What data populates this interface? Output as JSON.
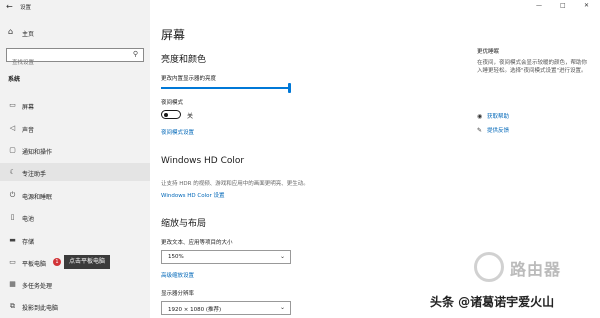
{
  "window": {
    "title": "设置",
    "controls": [
      "—",
      "□",
      "✕"
    ]
  },
  "sidebar": {
    "home_label": "主页",
    "search_placeholder": "查找设置",
    "section": "系统",
    "items": [
      {
        "label": "屏幕",
        "icon": "monitor-icon"
      },
      {
        "label": "声音",
        "icon": "speaker-icon"
      },
      {
        "label": "通知和操作",
        "icon": "notification-icon"
      },
      {
        "label": "专注助手",
        "icon": "moon-icon"
      },
      {
        "label": "电源和睡眠",
        "icon": "power-icon"
      },
      {
        "label": "电池",
        "icon": "battery-icon"
      },
      {
        "label": "存储",
        "icon": "storage-icon"
      },
      {
        "label": "平板电脑",
        "icon": "tablet-icon"
      },
      {
        "label": "多任务处理",
        "icon": "multitask-icon"
      },
      {
        "label": "投影到此电脑",
        "icon": "project-icon"
      }
    ],
    "badge": "1",
    "tooltip": "点击平板电脑"
  },
  "main": {
    "title": "屏幕",
    "brightness_heading": "亮度和颜色",
    "brightness_label": "更改内置显示器的亮度",
    "brightness_level": 1.0,
    "night_mode_label": "夜间模式",
    "night_mode_state": "关",
    "night_mode_link": "夜间模式设置",
    "hd_heading": "Windows HD Color",
    "hd_desc": "让支持 HDR 的视频、游戏和应用中的画面更明亮、更生动。",
    "hd_link": "Windows HD Color 设置",
    "scale_heading": "缩放与布局",
    "scale_label": "更改文本、应用等项目的大小",
    "scale_value": "150%",
    "scale_link": "高级缩放设置",
    "resolution_label": "显示器分辨率",
    "resolution_value": "1920 × 1080 (推荐)"
  },
  "aside": {
    "title": "更优睡眠",
    "text": "在夜间，夜间模式会显示较暖的颜色，帮助你入睡更轻松。选择\"夜间模式设置\"进行设置。",
    "help_link": "获取帮助",
    "feedback_link": "提供反馈"
  },
  "watermark": {
    "logo_text": "路由器",
    "credit": "头条 @诸葛诺宇爱火山"
  }
}
